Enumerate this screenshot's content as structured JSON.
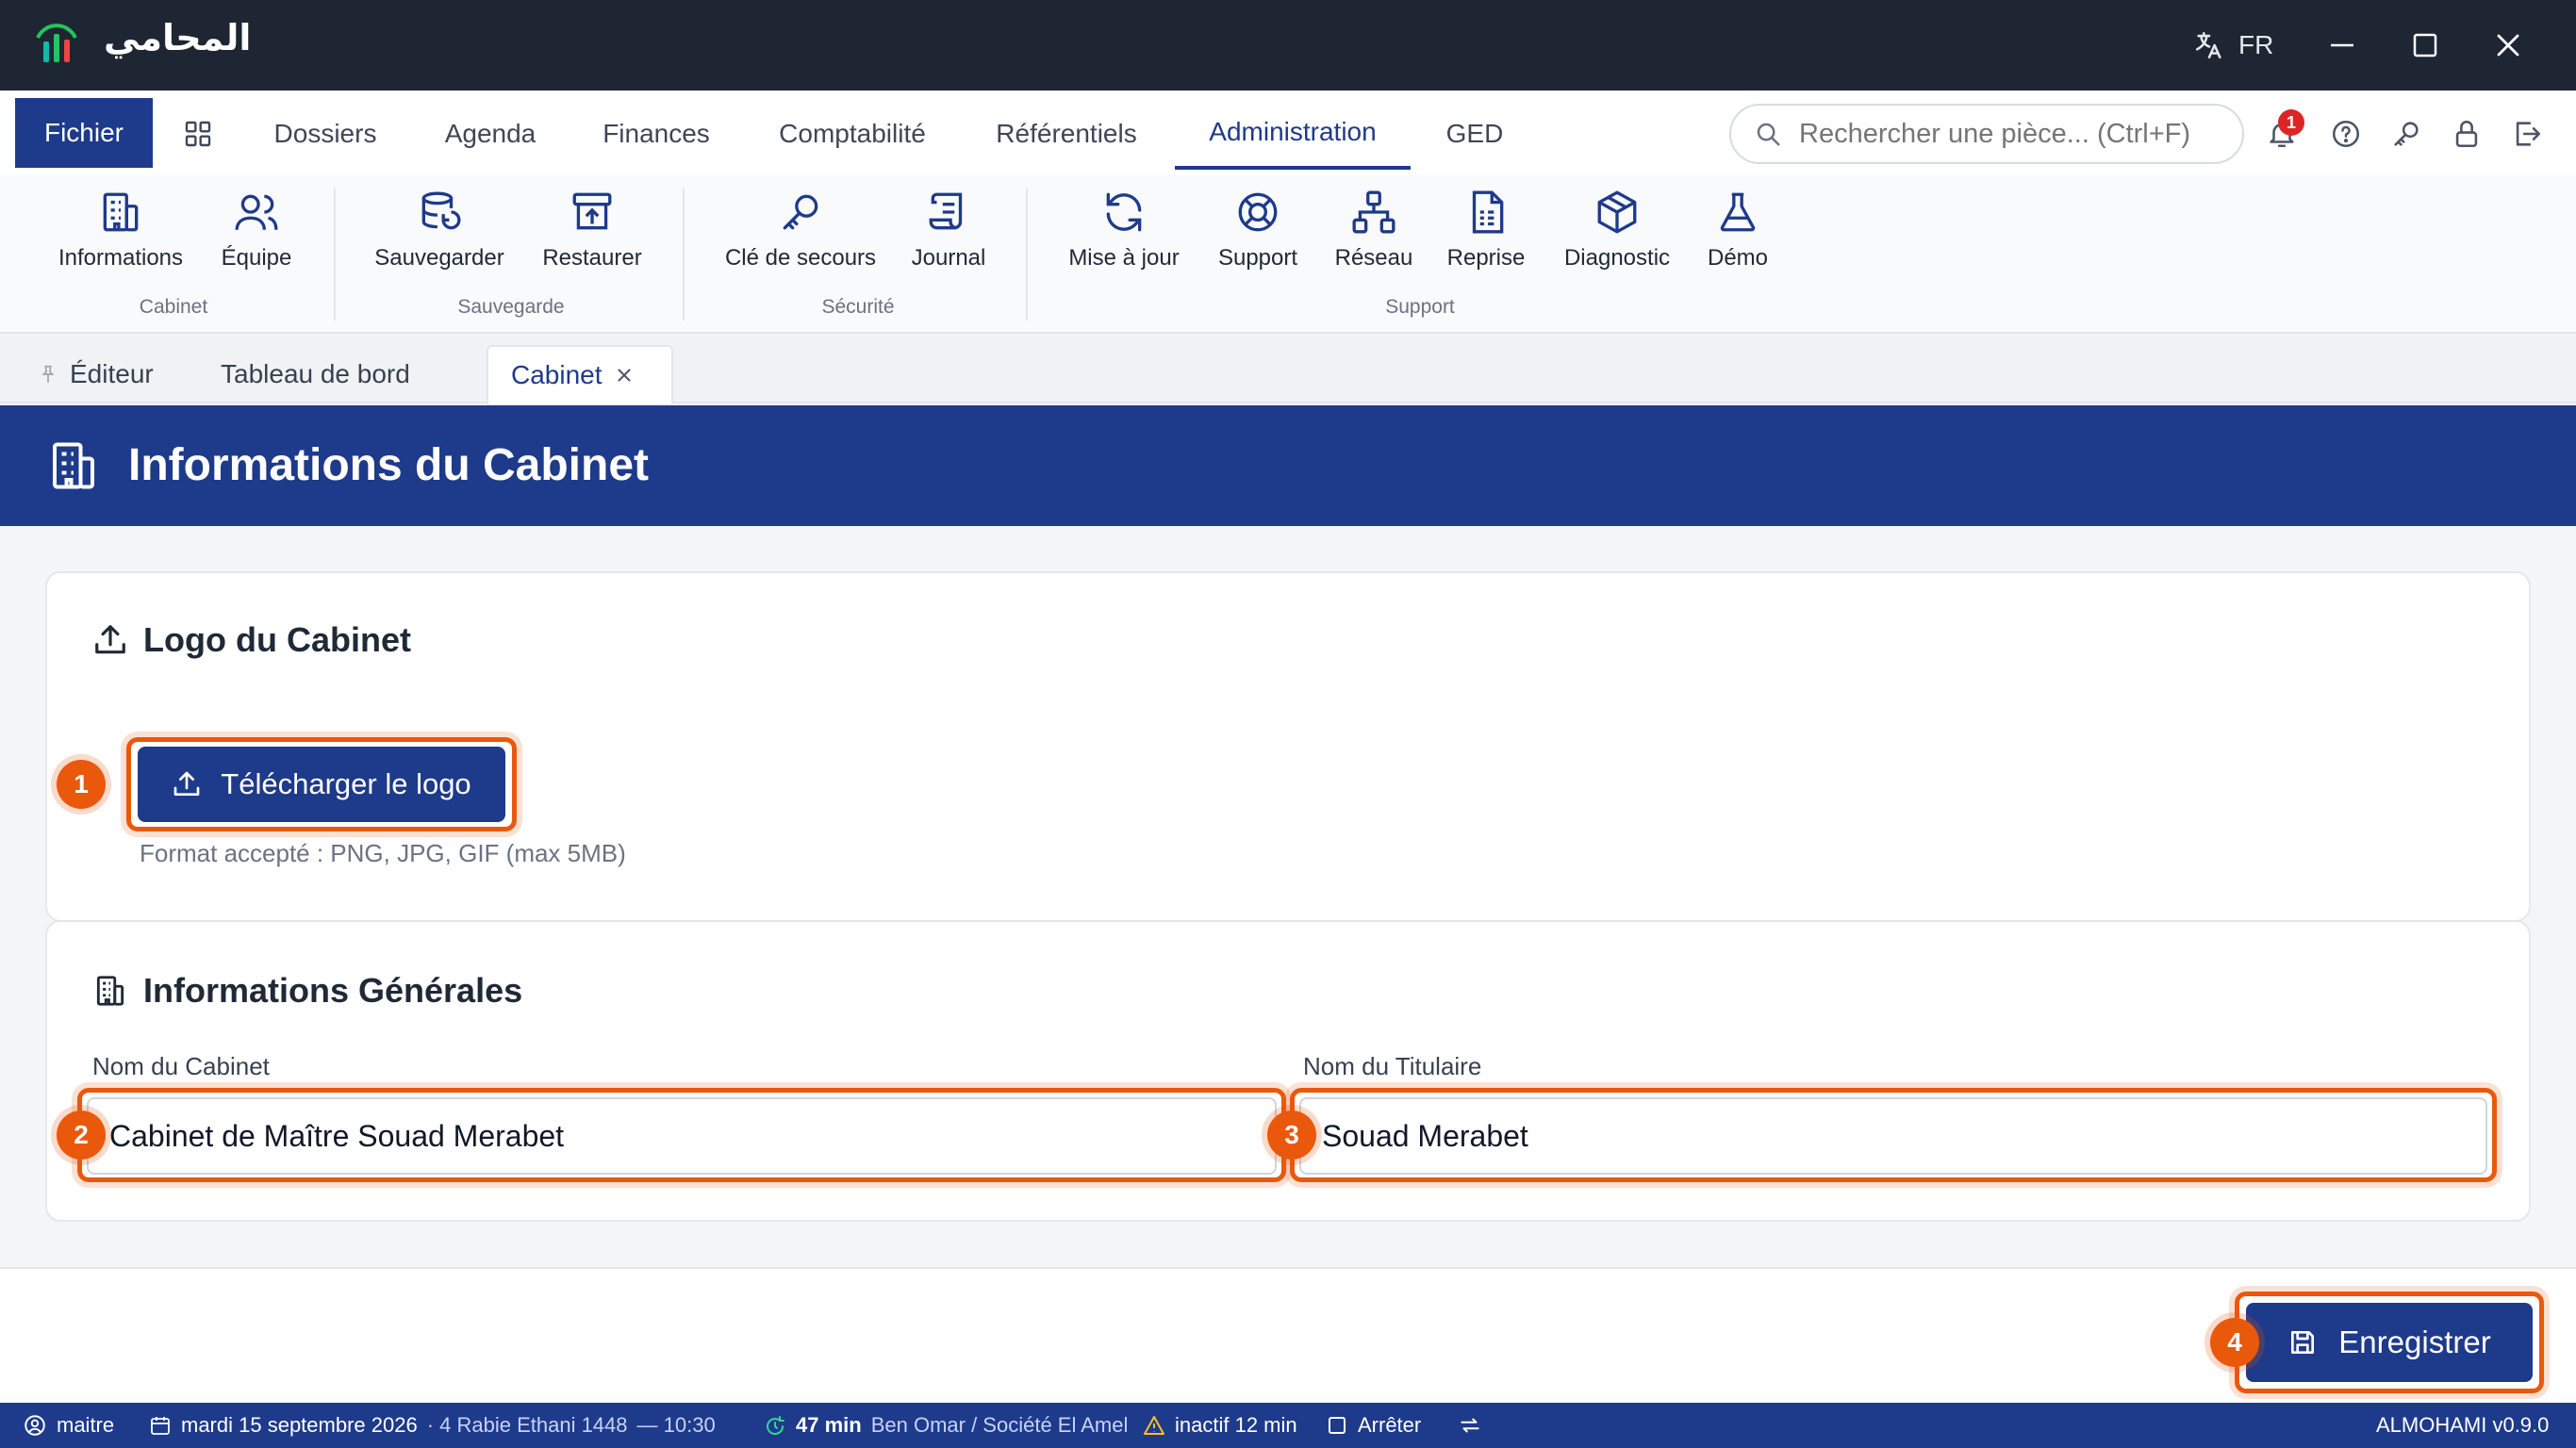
{
  "app": {
    "name": "المحامي",
    "language": "FR",
    "version": "ALMOHAMI v0.9.0"
  },
  "colors": {
    "brand": "#1e3a8a",
    "titlebar": "#1e2533",
    "highlight": "#ea580c",
    "badge": "#dc2626",
    "warning": "#fbbf24"
  },
  "ribbon_tabs": {
    "file": "Fichier",
    "dossiers": "Dossiers",
    "agenda": "Agenda",
    "finances": "Finances",
    "comptabilite": "Comptabilité",
    "referentiels": "Référentiels",
    "administration": "Administration",
    "ged": "GED",
    "active": "Administration"
  },
  "search": {
    "placeholder": "Rechercher une pièce... (Ctrl+F)"
  },
  "notifications": {
    "count": "1"
  },
  "ribbon": {
    "cabinet_group": "Cabinet",
    "informations": "Informations",
    "equipe": "Équipe",
    "sauvegarde_group": "Sauvegarde",
    "sauvegarder": "Sauvegarder",
    "restaurer": "Restaurer",
    "securite_group": "Sécurité",
    "cle_secours": "Clé de secours",
    "journal": "Journal",
    "support_group": "Support",
    "mise_a_jour": "Mise à jour",
    "support": "Support",
    "reseau": "Réseau",
    "reprise": "Reprise",
    "diagnostic": "Diagnostic",
    "demo": "Démo"
  },
  "doc_tabs": {
    "editeur": "Éditeur",
    "tableau_de_bord": "Tableau de bord",
    "cabinet": "Cabinet"
  },
  "page": {
    "title": "Informations du Cabinet"
  },
  "logo_section": {
    "title": "Logo du Cabinet",
    "upload_label": "Télécharger le logo",
    "hint": "Format accepté : PNG, JPG, GIF (max 5MB)"
  },
  "general_section": {
    "title": "Informations Générales",
    "cabinet_name_label": "Nom du Cabinet",
    "cabinet_name_value": "Cabinet de Maître Souad Merabet",
    "holder_label": "Nom du Titulaire",
    "holder_value": "Souad Merabet"
  },
  "actions": {
    "save": "Enregistrer"
  },
  "markers": [
    "1",
    "2",
    "3",
    "4"
  ],
  "status_bar": {
    "user": "maitre",
    "date": "mardi 15 septembre 2026",
    "hijri": "· 4 Rabie Ethani 1448",
    "time": "— 10:30",
    "timer": "47 min",
    "client": "Ben Omar / Société El Amel",
    "inactive": "inactif 12 min",
    "stop": "Arrêter"
  }
}
